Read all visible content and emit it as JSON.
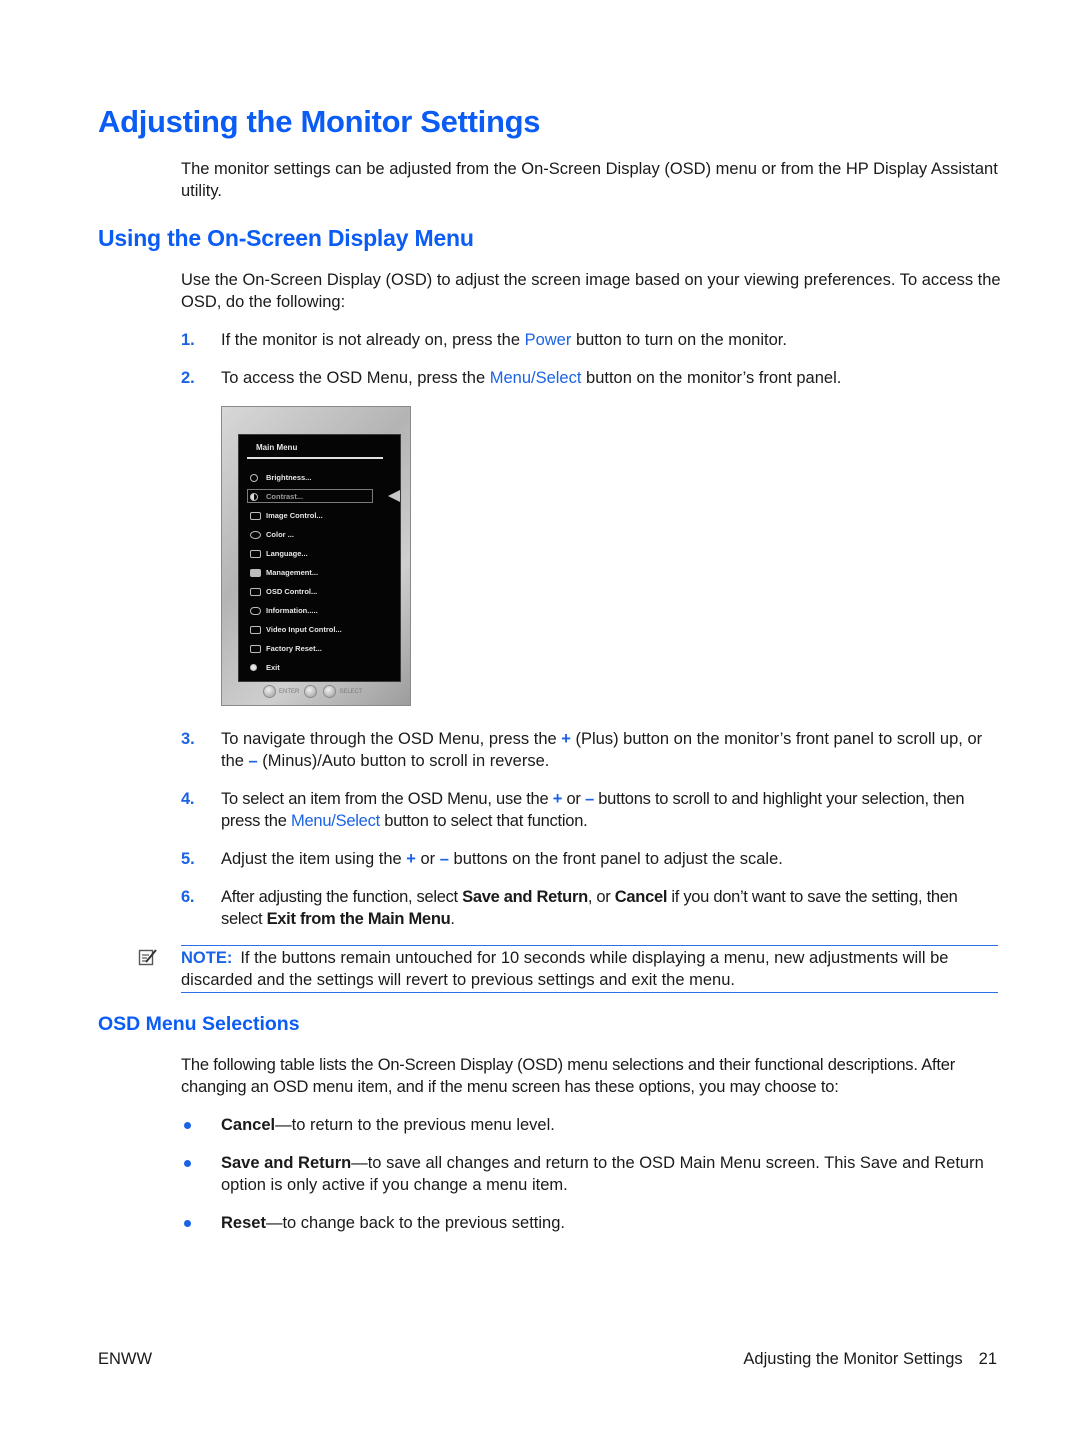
{
  "page": {
    "title": "Adjusting the Monitor Settings",
    "intro": "The monitor settings can be adjusted from the On-Screen Display (OSD) menu or from the HP Display Assistant utility.",
    "section1": {
      "heading": "Using the On-Screen Display Menu",
      "intro": "Use the On-Screen Display (OSD) to adjust the screen image based on your viewing preferences. To access the OSD, do the following:",
      "steps": [
        {
          "num": "1.",
          "pre": "If the monitor is not already on, press the ",
          "link": "Power",
          "post": " button to turn on the monitor."
        },
        {
          "num": "2.",
          "pre": "To access the OSD Menu, press the ",
          "link": "Menu/Select",
          "post": " button on the monitor’s front panel."
        },
        {
          "num": "3.",
          "a": "To navigate through the OSD Menu, press the ",
          "plus": "+",
          "b": " (Plus) button on the monitor’s front panel to scroll up, or the ",
          "minus": "–",
          "c": " (Minus)/Auto button to scroll in reverse."
        },
        {
          "num": "4.",
          "a": "To select an item from the OSD Menu, use the ",
          "plus": "+",
          "b": " or ",
          "minus": "–",
          "c": " buttons to scroll to and highlight your selection, then press the ",
          "link": "Menu/Select",
          "d": " button to select that function."
        },
        {
          "num": "5.",
          "a": "Adjust the item using the ",
          "plus": "+",
          "b": " or ",
          "minus": "–",
          "c": " buttons on the front panel to adjust the scale."
        },
        {
          "num": "6.",
          "a": "After adjusting the function, select ",
          "bold1": "Save and Return",
          "b": ", or ",
          "bold2": "Cancel",
          "c": " if you don’t want to save the setting, then select ",
          "bold3": "Exit from the Main Menu",
          "d": "."
        }
      ],
      "note": {
        "label": "NOTE:",
        "text": "If the buttons remain untouched for 10 seconds while displaying a menu, new adjustments will be discarded and the settings will revert to previous settings and exit the menu."
      }
    },
    "osd_image": {
      "menu_title": "Main Menu",
      "items": [
        {
          "label": "Brightness...",
          "icon": "sun-icon"
        },
        {
          "label": "Contrast...",
          "icon": "contrast-icon",
          "selected": true
        },
        {
          "label": "Image Control...",
          "icon": "image-control-icon"
        },
        {
          "label": "Color ...",
          "icon": "color-icon"
        },
        {
          "label": "Language...",
          "icon": "language-icon"
        },
        {
          "label": "Management...",
          "icon": "management-icon"
        },
        {
          "label": "OSD Control...",
          "icon": "osd-control-icon"
        },
        {
          "label": "Information.....",
          "icon": "information-icon"
        },
        {
          "label": "Video Input Control...",
          "icon": "video-input-icon"
        },
        {
          "label": "Factory Reset...",
          "icon": "factory-reset-icon"
        },
        {
          "label": "Exit",
          "icon": "exit-icon"
        }
      ],
      "bezel_enter": "ENTER",
      "bezel_select": "SELECT"
    },
    "section2": {
      "heading": "OSD Menu Selections",
      "intro": "The following table lists the On-Screen Display (OSD) menu selections and their functional descriptions. After changing an OSD menu item, and if the menu screen has these options, you may choose to:",
      "bullets": [
        {
          "term": "Cancel",
          "desc": "—to return to the previous menu level."
        },
        {
          "term": "Save and Return",
          "desc": "—to save all changes and return to the OSD Main Menu screen. This Save and Return option is only active if you change a menu item."
        },
        {
          "term": "Reset",
          "desc": "—to change back to the previous setting."
        }
      ]
    },
    "footer": {
      "left": "ENWW",
      "right_title": "Adjusting the Monitor Settings",
      "page_number": "21"
    }
  }
}
